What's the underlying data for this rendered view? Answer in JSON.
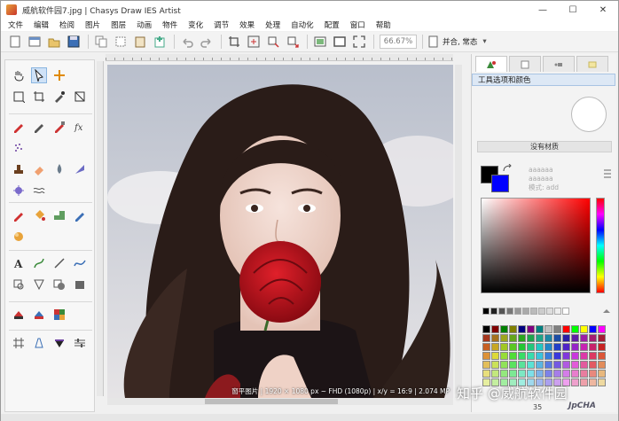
{
  "window": {
    "title": "威航软件园7.jpg | Chasys Draw IES Artist",
    "minimize": "—",
    "maximize": "☐",
    "close": "✕"
  },
  "menu": [
    "文件",
    "编辑",
    "检阅",
    "图片",
    "图层",
    "动画",
    "物件",
    "变化",
    "调节",
    "效果",
    "处理",
    "自动化",
    "配置",
    "窗口",
    "帮助"
  ],
  "toolbar": {
    "zoom": "66.67%",
    "fit_label": "并合, 常态"
  },
  "canvas": {
    "status": "窗平图片 | 1920 × 1080 px ~ FHD (1080p) | x/y = 16:9 | 2.074 MP"
  },
  "right_panel": {
    "header": "工具选项和颜色",
    "no_material": "没有材质",
    "hex_line1": "aaaaaa",
    "hex_line2": "aaaaaa",
    "hex_line3": "模式: add"
  },
  "watermark": "知乎 @威航软件园",
  "bottom": {
    "count": "35",
    "logo": "JpCHA"
  },
  "colors": {
    "foreground": "#000000",
    "background": "#0000ff",
    "accent": "#a9c4e3"
  }
}
